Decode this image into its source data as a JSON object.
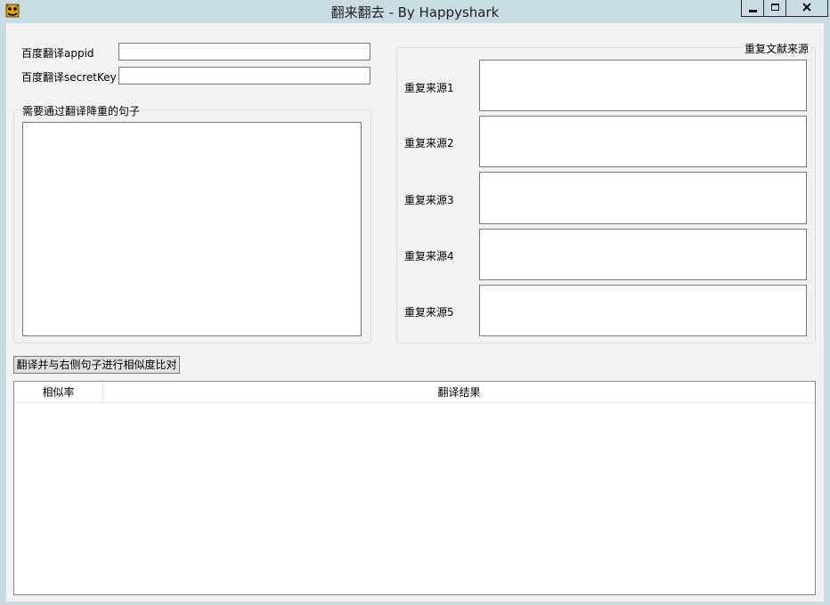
{
  "window": {
    "title": "翻来翻去 - By Happyshark",
    "controls": {
      "minimize_icon": "minimize-icon",
      "maximize_icon": "maximize-icon",
      "close_icon": "close-icon"
    }
  },
  "credentials": {
    "appid_label": "百度翻译appid",
    "appid_value": "",
    "secret_label": "百度翻译secretKey",
    "secret_value": ""
  },
  "source": {
    "group_title": "需要通过翻译降重的句子",
    "text": ""
  },
  "duplicates": {
    "group_title": "重复文献来源",
    "items": [
      {
        "label": "重复来源1",
        "text": ""
      },
      {
        "label": "重复来源2",
        "text": ""
      },
      {
        "label": "重复来源3",
        "text": ""
      },
      {
        "label": "重复来源4",
        "text": ""
      },
      {
        "label": "重复来源5",
        "text": ""
      }
    ]
  },
  "actions": {
    "translate_compare_label": "翻译并与右侧句子进行相似度比对"
  },
  "results": {
    "columns": [
      "相似率",
      "翻译结果"
    ],
    "rows": []
  },
  "colors": {
    "titlebar": "#c9dbe3",
    "client": "#f4f1f5",
    "border": "#7a7a7a"
  }
}
